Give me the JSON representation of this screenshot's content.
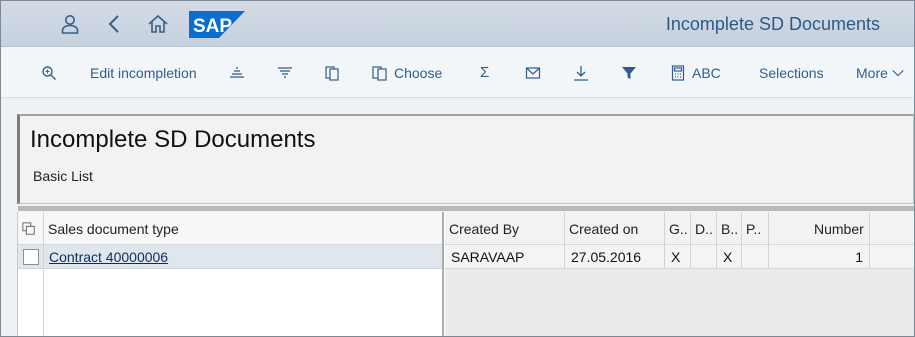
{
  "shell": {
    "title": "Incomplete SD Documents",
    "icons": [
      "user-icon",
      "back-icon",
      "home-icon"
    ],
    "logo_text": "SAP",
    "colors": {
      "shell_bg": "#c9d3df",
      "accent": "#2d5a84",
      "logo_blue": "#0a6ed1"
    }
  },
  "toolbar": {
    "edit_incompletion": "Edit incompletion",
    "choose": "Choose",
    "abc": "ABC",
    "selections": "Selections",
    "more": "More",
    "icons": [
      "zoom-icon",
      "sort-ascending-icon",
      "sort-descending-icon",
      "copy-icon",
      "copy-choose-icon",
      "sigma-icon",
      "mail-icon",
      "download-icon",
      "filter-icon",
      "calculator-icon",
      "chevron-down-icon"
    ]
  },
  "header": {
    "title": "Incomplete SD Documents",
    "subtitle": "Basic List"
  },
  "grid": {
    "left_header": "Sales document type",
    "right_headers": [
      "Created By",
      "Created on",
      "G..",
      "D..",
      "B..",
      "P..",
      "Number"
    ],
    "rows": [
      {
        "doc_type": "Contract 40000006",
        "created_by": "SARAVAAP",
        "created_on": "27.05.2016",
        "g": "X",
        "d": "",
        "b": "X",
        "p": "",
        "number": "1"
      }
    ]
  }
}
